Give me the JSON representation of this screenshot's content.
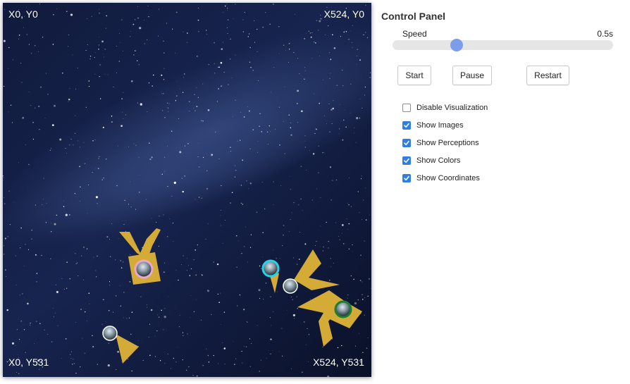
{
  "board": {
    "corner_top_left": "X0, Y0",
    "corner_top_right": "X524, Y0",
    "corner_bottom_left": "X0, Y531",
    "corner_bottom_right": "X524, Y531",
    "background": "starry-night-sky",
    "agent_color": "#d4ab36",
    "agents": [
      {
        "name": "agent-1",
        "ring_color": "#e9a7c9"
      },
      {
        "name": "agent-2",
        "ring_color": "#1d7f2e"
      }
    ],
    "orbs": [
      {
        "name": "orb-cyan",
        "ring_color": "#26d3e6"
      },
      {
        "name": "orb-plain-1",
        "ring_color": "#ffffff"
      },
      {
        "name": "orb-plain-2",
        "ring_color": "#ffffff"
      }
    ]
  },
  "control_panel": {
    "title": "Control Panel",
    "speed_label": "Speed",
    "speed_value": "0.5s",
    "speed_fraction": 0.29,
    "buttons": {
      "start": "Start",
      "pause": "Pause",
      "restart": "Restart"
    },
    "options": [
      {
        "label": "Disable Visualization",
        "checked": false
      },
      {
        "label": "Show Images",
        "checked": true
      },
      {
        "label": "Show Perceptions",
        "checked": true
      },
      {
        "label": "Show Colors",
        "checked": true
      },
      {
        "label": "Show Coordinates",
        "checked": true
      }
    ],
    "accent_color": "#2f7fe3"
  }
}
